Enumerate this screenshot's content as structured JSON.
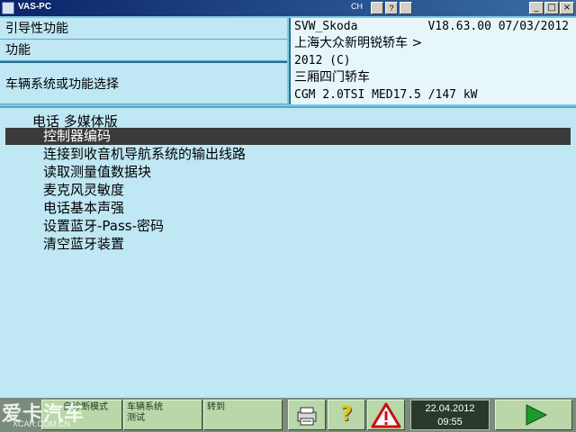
{
  "window": {
    "title": "VAS-PC",
    "tray_ch": "CH",
    "tray_help": "?",
    "minimize": "_",
    "maximize": "□",
    "close": "×"
  },
  "header": {
    "left": {
      "row1": "引导性功能",
      "row2": "功能",
      "row3": "车辆系统或功能选择"
    },
    "right": {
      "brand": "SVW_Skoda",
      "version": "V18.63.00 07/03/2012",
      "model": "上海大众新明锐轿车 >",
      "year": "2012 (C)",
      "body": "三厢四门轿车",
      "engine": "CGM 2.0TSI MED17.5 /147 kW"
    }
  },
  "main": {
    "group_title": "电话 多媒体版",
    "items": [
      "控制器编码",
      "连接到收音机导航系统的输出线路",
      "读取测量值数据块",
      "麦克风灵敏度",
      "电话基本声强",
      "设置蓝牙-Pass-密码",
      "清空蓝牙装置"
    ],
    "selected_index": 0
  },
  "bottom": {
    "btn1_label": "自诊断模式",
    "btn2_label": "车辆系统\n测试",
    "btn3_label": "转到",
    "print_icon": "printer-icon",
    "help_icon": "question-icon",
    "help_glyph": "?",
    "warning_icon": "warning-icon",
    "date": "22.04.2012",
    "time": "09:55",
    "next_icon": "play-icon",
    "watermark": "爱卡汽车",
    "watermark_sub": "XCAR.COM.CN"
  },
  "colors": {
    "header_bg": "#7fcae6",
    "list_bg": "#bfe7f4",
    "selected_bg": "#3a3a3a",
    "bottom_btn": "#b9d7a8",
    "play_green": "#1f9a2a",
    "warning_red": "#cc1010"
  }
}
